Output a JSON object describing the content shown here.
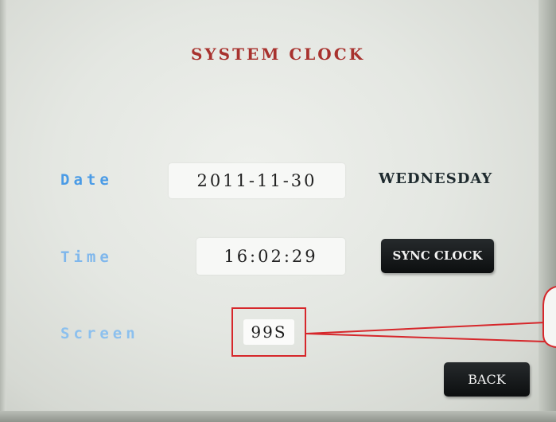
{
  "screen": {
    "title": "SYSTEM CLOCK"
  },
  "date_row": {
    "label": "Date",
    "value": "2011-11-30",
    "weekday": "WEDNESDAY"
  },
  "time_row": {
    "label": "Time",
    "value": "16:02:29",
    "sync_button_label": "SYNC CLOCK"
  },
  "screen_row": {
    "label": "Screen",
    "value": "99S"
  },
  "footer": {
    "back_label": "BACK"
  },
  "colors": {
    "title": "#a8322e",
    "label": "#4a9be6",
    "callout": "#d6272b",
    "button": "#111416"
  }
}
